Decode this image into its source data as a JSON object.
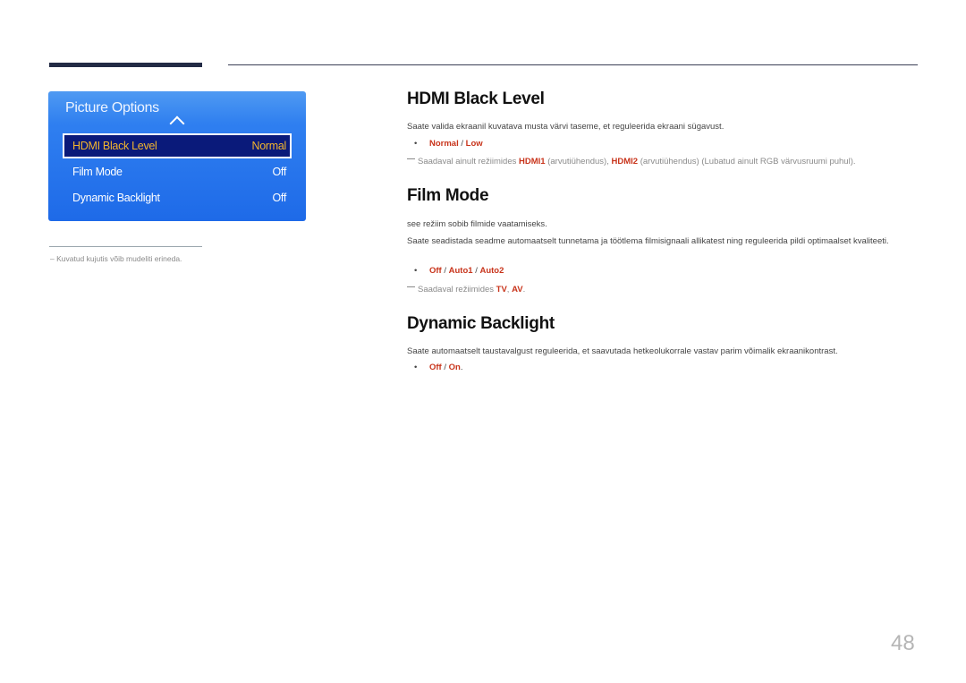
{
  "panel": {
    "title": "Picture Options",
    "items": [
      {
        "label": "HDMI Black Level",
        "value": "Normal",
        "selected": true
      },
      {
        "label": "Film Mode",
        "value": "Off",
        "selected": false
      },
      {
        "label": "Dynamic Backlight",
        "value": "Off",
        "selected": false
      }
    ]
  },
  "side_note": "Kuvatud kujutis võib mudeliti erineda.",
  "sections": {
    "hdmi": {
      "title": "HDMI Black Level",
      "desc": "Saate valida ekraanil kuvatava musta värvi taseme, et reguleerida ekraani sügavust.",
      "options": [
        "Normal",
        "Low"
      ],
      "sep": " / ",
      "note_prefix": "Saadaval ainult režiimides ",
      "note_hdmi1": "HDMI1",
      "note_mid1": " (arvutiühendus), ",
      "note_hdmi2": "HDMI2",
      "note_suffix": " (arvutiühendus) (Lubatud ainult RGB värvusruumi puhul)."
    },
    "film": {
      "title": "Film Mode",
      "desc1": "see režiim sobib filmide vaatamiseks.",
      "desc2": "Saate seadistada seadme automaatselt tunnetama ja töötlema filmisignaali allikatest ning reguleerida pildi optimaalset kvaliteeti.",
      "options": [
        "Off",
        "Auto1",
        "Auto2"
      ],
      "sep": " / ",
      "note_prefix": "Saadaval režiimides ",
      "note_tv": "TV",
      "note_comma": ", ",
      "note_av": "AV",
      "note_end": "."
    },
    "backlight": {
      "title": "Dynamic Backlight",
      "desc": "Saate automaatselt taustavalgust reguleerida, et saavutada hetkeolukorrale vastav parim võimalik ekraanikontrast.",
      "options": [
        "Off",
        "On"
      ],
      "sep": " / ",
      "end": "."
    }
  },
  "page_number": "48",
  "bullet": "•"
}
